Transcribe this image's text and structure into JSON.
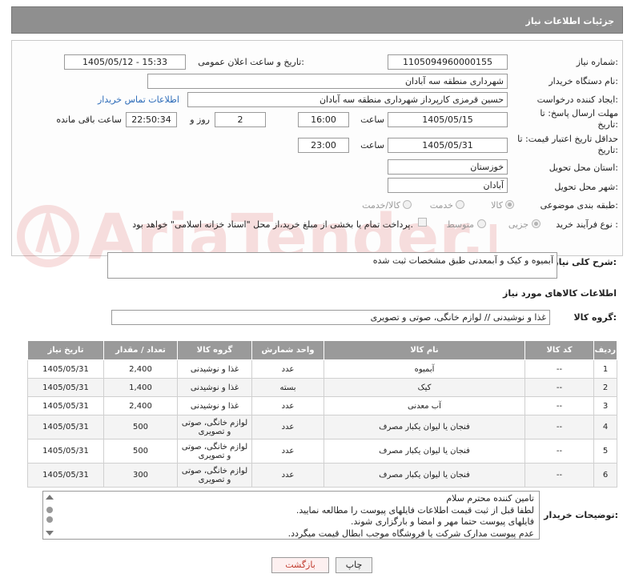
{
  "header": {
    "title": "جزئیات اطلاعات نیاز"
  },
  "form": {
    "need_number_label": "شماره نیاز:",
    "need_number": "1105094960000155",
    "announce_label": "تاریخ و ساعت اعلان عمومی:",
    "announce_value": "1405/05/12 - 15:33",
    "buyer_label": "نام دستگاه خریدار:",
    "buyer_value": "شهرداری منطقه سه آبادان",
    "creator_label": "ایجاد کننده درخواست:",
    "creator_value": "حسین قرمزی کارپرداز شهرداری منطقه سه آبادان",
    "contact_link": "اطلاعات تماس خریدار",
    "deadline_label": "مهلت ارسال پاسخ: تا تاریخ:",
    "deadline_date": "1405/05/15",
    "time_label": "ساعت",
    "deadline_time": "16:00",
    "days_value": "2",
    "days_label": "روز و",
    "remaining_time": "22:50:34",
    "remaining_label": "ساعت باقی مانده",
    "validity_label": "حداقل تاریخ اعتبار قیمت: تا تاریخ:",
    "validity_date": "1405/05/31",
    "validity_time_label": "ساعت",
    "validity_time": "23:00",
    "province_label": "استان محل تحویل:",
    "province_value": "خوزستان",
    "city_label": "شهر محل تحویل:",
    "city_value": "آبادان",
    "category_label": "طبقه بندی موضوعی:",
    "category_options": [
      "کالا",
      "خدمت",
      "کالا/خدمت"
    ],
    "category_selected": "کالا",
    "process_label": "نوع فرآیند خرید :",
    "process_options": [
      "جزیی",
      "متوسط"
    ],
    "process_selected": "جزیی",
    "payment_note": "پرداخت تمام یا بخشی از مبلغ خرید،از محل \"اسناد خزانه اسلامی\" خواهد بود."
  },
  "description": {
    "label": "شرح کلی نیاز:",
    "value": "آبمیوه و کیک و آبمعدنی طبق مشخصات ثبت شده"
  },
  "goods": {
    "section_title": "اطلاعات کالاهای مورد نیاز",
    "group_label": "گروه کالا:",
    "group_value": "غذا و نوشیدنی // لوازم خانگی، صوتی و تصویری",
    "columns": [
      "ردیف",
      "کد کالا",
      "نام کالا",
      "واحد شمارش",
      "گروه کالا",
      "تعداد / مقدار",
      "تاریخ نیاز"
    ],
    "rows": [
      [
        "1",
        "--",
        "آبمیوه",
        "عدد",
        "غذا و نوشیدنی",
        "2,400",
        "1405/05/31"
      ],
      [
        "2",
        "--",
        "کیک",
        "بسته",
        "غذا و نوشیدنی",
        "1,400",
        "1405/05/31"
      ],
      [
        "3",
        "--",
        "آب معدنی",
        "عدد",
        "غذا و نوشیدنی",
        "2,400",
        "1405/05/31"
      ],
      [
        "4",
        "--",
        "فنجان یا لیوان یکبار مصرف",
        "عدد",
        "لوازم خانگی، صوتی و تصویری",
        "500",
        "1405/05/31"
      ],
      [
        "5",
        "--",
        "فنجان یا لیوان یکبار مصرف",
        "عدد",
        "لوازم خانگی، صوتی و تصویری",
        "500",
        "1405/05/31"
      ],
      [
        "6",
        "--",
        "فنجان یا لیوان یکبار مصرف",
        "عدد",
        "لوازم خانگی، صوتی و تصویری",
        "300",
        "1405/05/31"
      ]
    ]
  },
  "buyer_notes": {
    "label": "توضیحات خریدار:",
    "lines": [
      "تامین کننده محترم سلام",
      "لطفا قبل از ثبت قیمت اطلاعات فایلهای پیوست را مطالعه نمایید.",
      "فایلهای پیوست حتما مهر و امضا و بارگزاری شوند.",
      "عدم پیوست مدارک شرکت یا فروشگاه موجب ابطال قیمت میگردد."
    ]
  },
  "buttons": {
    "print": "چاپ",
    "back": "بازگشت"
  },
  "watermark_text": "AriaTender.net",
  "colors": {
    "header_bg": "#8f8f8f",
    "link": "#2a6ab8",
    "table_header": "#9a9a9a"
  }
}
